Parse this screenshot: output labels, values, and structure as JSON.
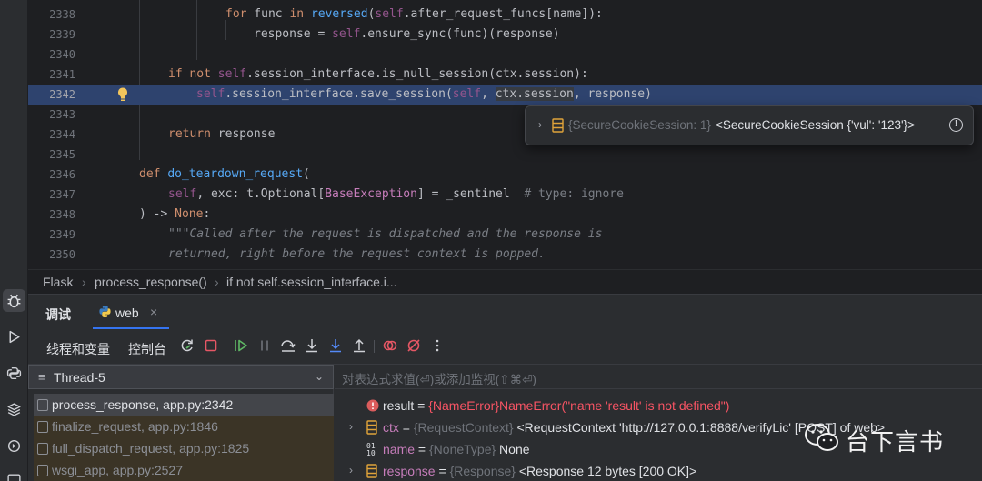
{
  "editor": {
    "lines": [
      {
        "num": "2338",
        "code": "for_func"
      },
      {
        "num": "2339",
        "code": "response_assign"
      },
      {
        "num": "2340",
        "code": "blank"
      },
      {
        "num": "2341",
        "code": "if_null"
      },
      {
        "num": "2342",
        "code": "save_session"
      },
      {
        "num": "2343",
        "code": "blank"
      },
      {
        "num": "2344",
        "code": "return"
      },
      {
        "num": "2345",
        "code": "blank"
      },
      {
        "num": "2346",
        "code": "def_teardown"
      },
      {
        "num": "2347",
        "code": "self_exc"
      },
      {
        "num": "2348",
        "code": "arrow_none"
      },
      {
        "num": "2349",
        "code": "docstring1"
      },
      {
        "num": "2350",
        "code": "docstring2"
      }
    ],
    "current_line": "2342"
  },
  "code_text": {
    "l2338_kw1": "for",
    "l2338_a": " func ",
    "l2338_kw2": "in",
    "l2338_b": " ",
    "l2338_fn": "reversed",
    "l2338_c": "(",
    "l2338_self": "self",
    "l2338_d": ".after_request_funcs[name]):",
    "l2339_a": "response = ",
    "l2339_self": "self",
    "l2339_b": ".ensure_sync(func)(response)",
    "l2341_kw1": "if",
    "l2341_b": " ",
    "l2341_kw2": "not",
    "l2341_c": " ",
    "l2341_self": "self",
    "l2341_d": ".session_interface.is_null_session(ctx.session):",
    "l2342_self1": "self",
    "l2342_a": ".session_interface.save_session(",
    "l2342_self2": "self",
    "l2342_b": ", ",
    "l2342_hl": "ctx.session",
    "l2342_c": ", response)",
    "l2344_kw": "return",
    "l2344_a": " response",
    "l2346_kw": "def",
    "l2346_b": " ",
    "l2346_fn": "do_teardown_request",
    "l2346_c": "(",
    "l2347_self": "self",
    "l2347_a": ", exc: t.Optional[",
    "l2347_bi": "BaseException",
    "l2347_b": "] = _sentinel  ",
    "l2347_cm": "# type: ignore",
    "l2348_a": ") -> ",
    "l2348_kw": "None",
    "l2348_b": ":",
    "l2349_doc": "\"\"\"Called after the request is dispatched and the response is",
    "l2350_doc": "returned, right before the request context is popped."
  },
  "popup": {
    "type": "{SecureCookieSession: 1}",
    "value": "<SecureCookieSession {'vul': '123'}>",
    "info": "!"
  },
  "breadcrumb": {
    "items": [
      "Flask",
      "process_response()",
      "if not self.session_interface.i..."
    ],
    "sep": "›"
  },
  "debug": {
    "title": "调试",
    "tab_label": "web",
    "tab_close": "×",
    "tabs": {
      "threads_vars": "线程和变量",
      "console": "控制台"
    },
    "thread": {
      "name": "Thread-5",
      "icon": "≡",
      "dropdown": "⌄"
    },
    "frames": [
      "process_response, app.py:2342",
      "finalize_request, app.py:1846",
      "full_dispatch_request, app.py:1825",
      "wsgi_app, app.py:2527"
    ],
    "eval_placeholder": "对表达式求值(⏎)或添加监视(⇧⌘⏎)",
    "variables": [
      {
        "name": "result",
        "eq": " = ",
        "type": "{NameError}",
        "value": "NameError(\"name 'result' is not defined\")"
      },
      {
        "name": "ctx",
        "eq": " = ",
        "type": "{RequestContext}",
        "value": " <RequestContext 'http://127.0.0.1:8888/verifyLic' [POST] of web>"
      },
      {
        "name": "name",
        "eq": " = ",
        "type": "{NoneType}",
        "value": " None"
      },
      {
        "name": "response",
        "eq": " = ",
        "type": "{Response}",
        "value": " <Response 12 bytes [200 OK]>"
      }
    ],
    "var_icon_binary": "01\n10"
  },
  "watermark": {
    "text": "台下言书"
  },
  "colors": {
    "current_line": "#2e436e",
    "accent": "#3574f0",
    "error": "#f75464",
    "keyword": "#cf8e6d",
    "function": "#56a8f5",
    "self": "#94558d"
  }
}
